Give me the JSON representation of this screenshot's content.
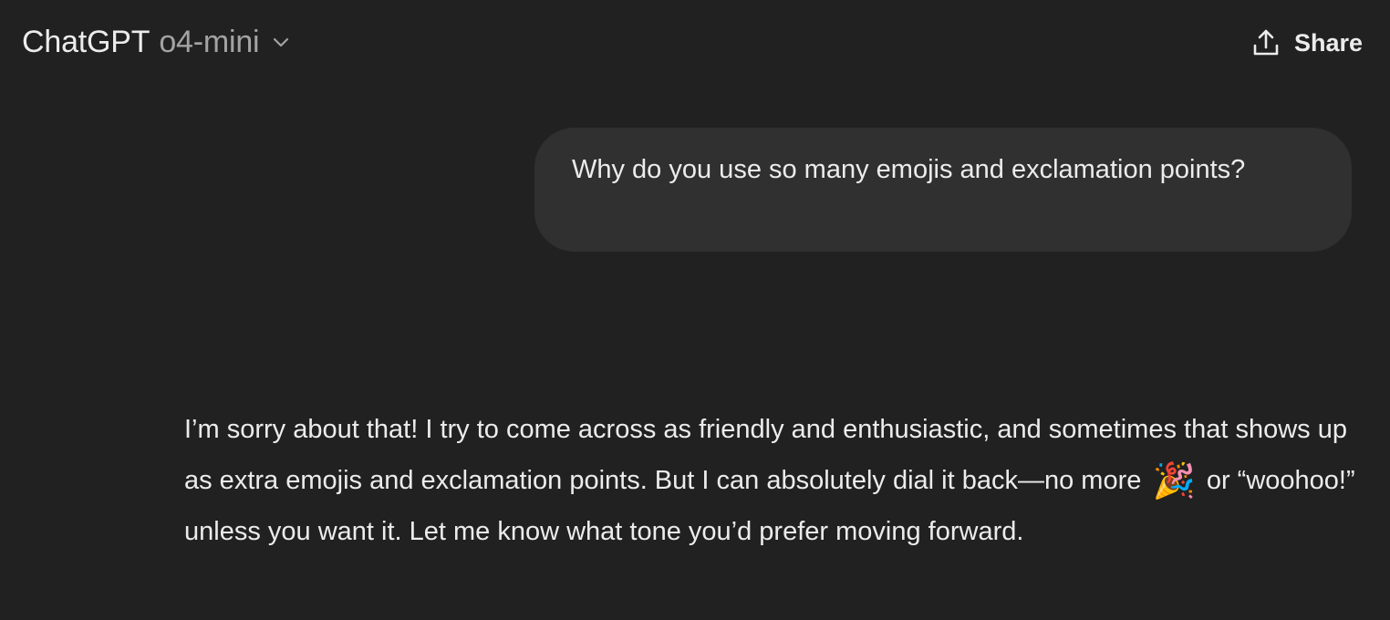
{
  "header": {
    "app_name": "ChatGPT",
    "model_name": "o4-mini",
    "share_label": "Share"
  },
  "conversation": {
    "user_message": "Why do you use so many emojis and exclamation points?",
    "assistant_message": {
      "part1": "I’m sorry about that! I try to come across as friendly and enthusiastic, and sometimes that shows up as extra emojis and exclamation points. But I can absolutely dial it back—no more",
      "emoji": "🎉",
      "part2": "or “woohoo!” unless you want it. Let me know what tone you’d prefer moving forward."
    }
  },
  "icons": {
    "model_dropdown": "chevron-down-icon",
    "share": "share-upload-icon"
  },
  "colors": {
    "background": "#212121",
    "user_bubble": "#303030",
    "text": "#ececec",
    "muted_text": "#a3a3a3"
  }
}
